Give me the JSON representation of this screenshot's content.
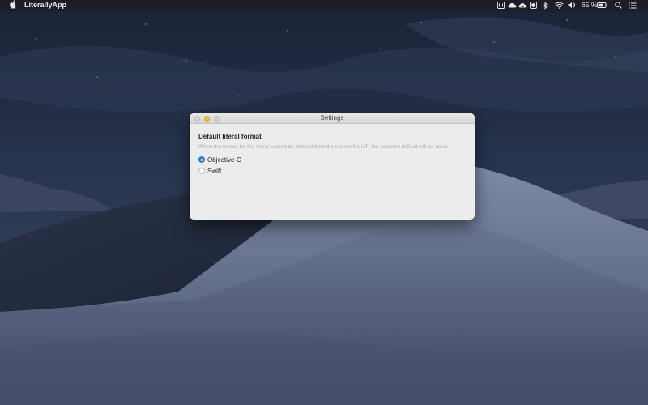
{
  "menubar": {
    "app_name": "LiterallyApp",
    "battery_percent": "65 %",
    "status_icons": [
      "app-status-icon",
      "cloud-icon",
      "cloud-sync-icon",
      "shield-icon",
      "bluetooth-icon",
      "wifi-icon",
      "volume-icon",
      "battery-icon",
      "spotlight-search-icon",
      "notification-center-icon"
    ]
  },
  "window": {
    "title": "Settings",
    "section_title": "Default literal format",
    "description": "When the format for the literal cannot be derived from the source file UTI the selected default will be used.",
    "options": [
      {
        "label": "Objective-C",
        "selected": true
      },
      {
        "label": "Swift",
        "selected": false
      }
    ]
  },
  "colors": {
    "accent": "#3b82e2",
    "minimize_button": "#f5bd4f",
    "menubar_bg": "#1b1e24"
  }
}
